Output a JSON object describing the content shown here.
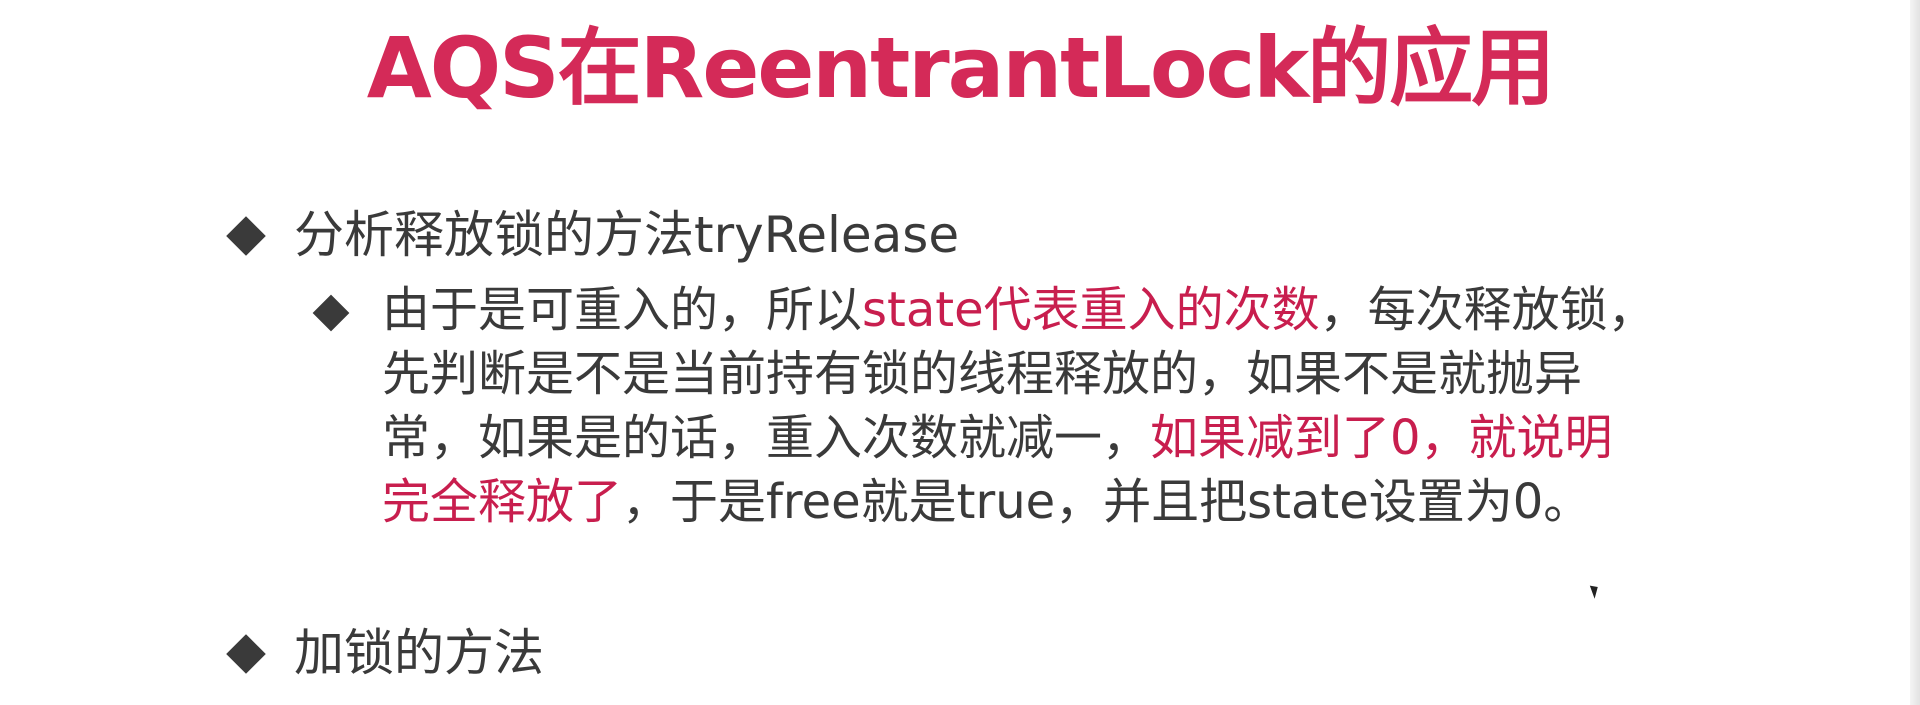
{
  "slide": {
    "title": "AQS在ReentrantLock的应用",
    "bullets": [
      {
        "text": "分析释放锁的方法tryRelease",
        "sub": {
          "lines": [
            [
              {
                "text": "由于是可重入的，所以",
                "highlight": false
              },
              {
                "text": "state代表重入的次数",
                "highlight": true
              },
              {
                "text": "，每次释放锁，",
                "highlight": false
              }
            ],
            [
              {
                "text": "先判断是不是当前持有锁的线程释放的，如果不是就抛异",
                "highlight": false
              }
            ],
            [
              {
                "text": "常，如果是的话，重入次数就减一，",
                "highlight": false
              },
              {
                "text": "如果减到了0，就说明",
                "highlight": true
              }
            ],
            [
              {
                "text": "完全释放了",
                "highlight": true
              },
              {
                "text": "，于是free就是true，并且把state设置为0。",
                "highlight": false
              }
            ]
          ]
        }
      },
      {
        "text": "加锁的方法"
      }
    ]
  },
  "colors": {
    "title": "#d42a58",
    "highlight": "#c81e4e",
    "body": "#3a3a3a",
    "bullet": "#3a3a3a"
  },
  "icons": {
    "bullet": "diamond-bullet-icon",
    "cursor": "mouse-cursor-icon"
  }
}
